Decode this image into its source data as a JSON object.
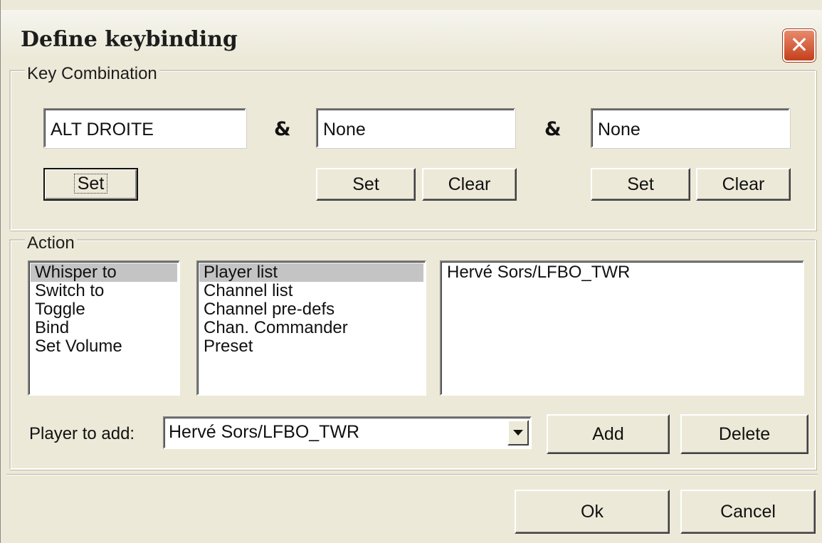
{
  "window": {
    "title": "Define keybinding",
    "close_icon": "close-icon",
    "accent_color": "#c4401c"
  },
  "key_combination": {
    "group_label": "Key Combination",
    "separator": "&",
    "keys": [
      {
        "value": "ALT DROITE",
        "set_label": "Set"
      },
      {
        "value": "None",
        "set_label": "Set",
        "clear_label": "Clear"
      },
      {
        "value": "None",
        "set_label": "Set",
        "clear_label": "Clear"
      }
    ]
  },
  "action": {
    "group_label": "Action",
    "actions": [
      "Whisper to",
      "Switch to",
      "Toggle",
      "Bind",
      "Set Volume"
    ],
    "selected_action": "Whisper to",
    "targets": [
      "Player list",
      "Channel list",
      "Channel pre-defs",
      "Chan. Commander",
      "Preset"
    ],
    "selected_target": "Player list",
    "players": [
      "Hervé Sors/LFBO_TWR"
    ],
    "player_to_add_label": "Player to add:",
    "player_to_add_value": "Hervé Sors/LFBO_TWR",
    "add_label": "Add",
    "delete_label": "Delete"
  },
  "footer": {
    "ok_label": "Ok",
    "cancel_label": "Cancel"
  }
}
